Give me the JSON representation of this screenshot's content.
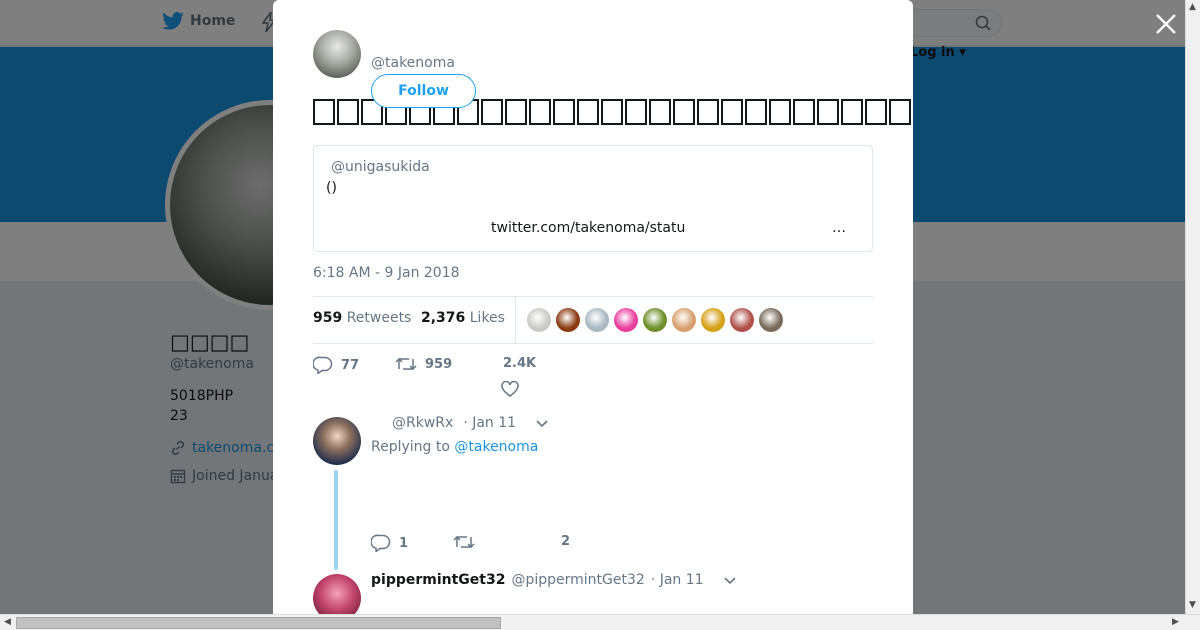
{
  "nav": {
    "home_label": "Home",
    "login_label": "Log in ▾"
  },
  "profile": {
    "name": "□□□□",
    "handle": "@takenoma",
    "bio_line1": "5018PHP",
    "bio_line2": "23",
    "url": "takenoma.c",
    "joined": "Joined Janua"
  },
  "tweet": {
    "author_handle": "@takenoma",
    "follow_label": "Follow",
    "quote": {
      "handle": "@unigasukida",
      "body": "()",
      "link": "twitter.com/takenoma/statu",
      "more": "…"
    },
    "timestamp": "6:18 AM - 9 Jan 2018",
    "retweets_count": "959",
    "retweets_label": "Retweets",
    "likes_count": "2,376",
    "likes_label": "Likes",
    "reply_count": "77",
    "retweet_count": "959",
    "like_count": "2.4K"
  },
  "liker_colors": [
    "#c9cbc6",
    "#8a3b12",
    "#aab8c2",
    "#e83e9c",
    "#6f8f2a",
    "#d8a070",
    "#d4a017",
    "#b0524a",
    "#7a6a5a"
  ],
  "replies": [
    {
      "handle": "@RkwRx",
      "date": "· Jan 11",
      "replying_prefix": "Replying to",
      "replying_to": "@takenoma",
      "reply_count": "1",
      "like_count": "2"
    },
    {
      "name": "pippermintGet32",
      "handle": "@pippermintGet32",
      "date": "· Jan 11"
    }
  ],
  "colors": {
    "accent": "#1da1f2",
    "banner": "#1b95e0"
  }
}
